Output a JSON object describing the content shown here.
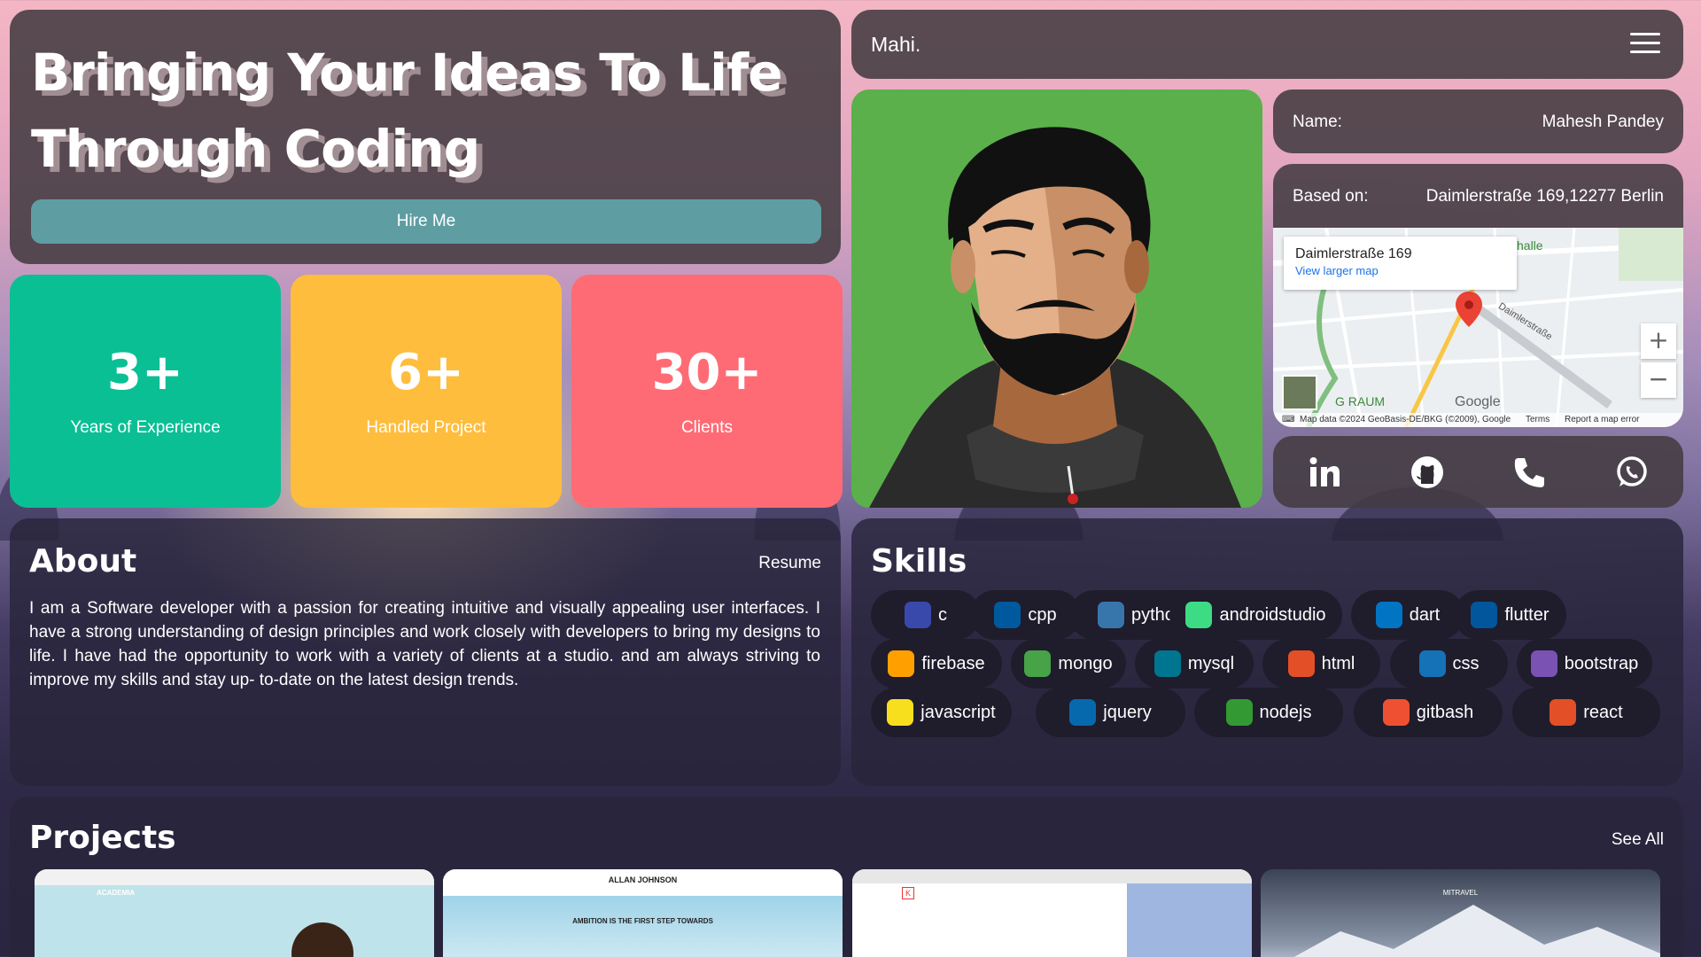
{
  "hero": {
    "title": "Bringing Your Ideas To Life Through Coding",
    "hire_label": "Hire Me"
  },
  "stats": [
    {
      "value": "3+",
      "label": "Years of Experience",
      "color": "#0abf94"
    },
    {
      "value": "6+",
      "label": "Handled Project",
      "color": "#ffbd3d"
    },
    {
      "value": "30+",
      "label": "Clients",
      "color": "#ff6b75"
    }
  ],
  "nav": {
    "brand": "Mahi.",
    "menu_icon": "hamburger-icon"
  },
  "info": {
    "name_key": "Name:",
    "name_value": "Mahesh Pandey",
    "location_key": "Based on:",
    "location_value": "Daimlerstraße 169,12277 Berlin"
  },
  "map": {
    "place": "Daimlerstraße 169",
    "link": "View larger map",
    "street_label": "Daimlerstraße",
    "area_label": "G RAUM",
    "halle_label": "halle",
    "brand": "Google",
    "zoom_in": "+",
    "zoom_out": "−",
    "attribution": "Map data ©2024 GeoBasis-DE/BKG (©2009), Google",
    "terms": "Terms",
    "report": "Report a map error"
  },
  "social": [
    "linkedin-icon",
    "github-icon",
    "phone-icon",
    "whatsapp-icon"
  ],
  "about": {
    "heading": "About",
    "resume_label": "Resume",
    "text": "I am a Software developer with a passion for creating intuitive and visually appealing user interfaces. I have a strong understanding of design principles and work closely with developers to bring my designs to life. I have had the opportunity to work with a variety of clients at a studio. and am always striving to improve my skills and stay up- to-date on the latest design trends."
  },
  "skills": {
    "heading": "Skills",
    "items": [
      {
        "label": "c",
        "color": "#3949ab"
      },
      {
        "label": "cpp",
        "color": "#00599c"
      },
      {
        "label": "python",
        "color": "#3776ab"
      },
      {
        "label": "androidstudio",
        "color": "#3ddc84"
      },
      {
        "label": "dart",
        "color": "#0175c2"
      },
      {
        "label": "flutter",
        "color": "#02569b"
      },
      {
        "label": "firebase",
        "color": "#ffa000"
      },
      {
        "label": "mongo",
        "color": "#47a248"
      },
      {
        "label": "mysql",
        "color": "#00758f"
      },
      {
        "label": "html",
        "color": "#e34f26"
      },
      {
        "label": "css",
        "color": "#1572b6"
      },
      {
        "label": "bootstrap",
        "color": "#7952b3"
      },
      {
        "label": "javascript",
        "color": "#f7df1e"
      },
      {
        "label": "jquery",
        "color": "#0769ad"
      },
      {
        "label": "nodejs",
        "color": "#339933"
      },
      {
        "label": "gitbash",
        "color": "#f05032"
      },
      {
        "label": "react",
        "color": "#e34f26"
      }
    ]
  },
  "projects": {
    "heading": "Projects",
    "see_all_label": "See All",
    "items": [
      {
        "title": "ACADEMIA",
        "subtitle": ""
      },
      {
        "title": "ALLAN JOHNSON",
        "subtitle": "AMBITION IS THE FIRST STEP TOWARDS"
      },
      {
        "title": "K",
        "subtitle": ""
      },
      {
        "title": "MITRAVEL",
        "subtitle": ""
      }
    ]
  }
}
